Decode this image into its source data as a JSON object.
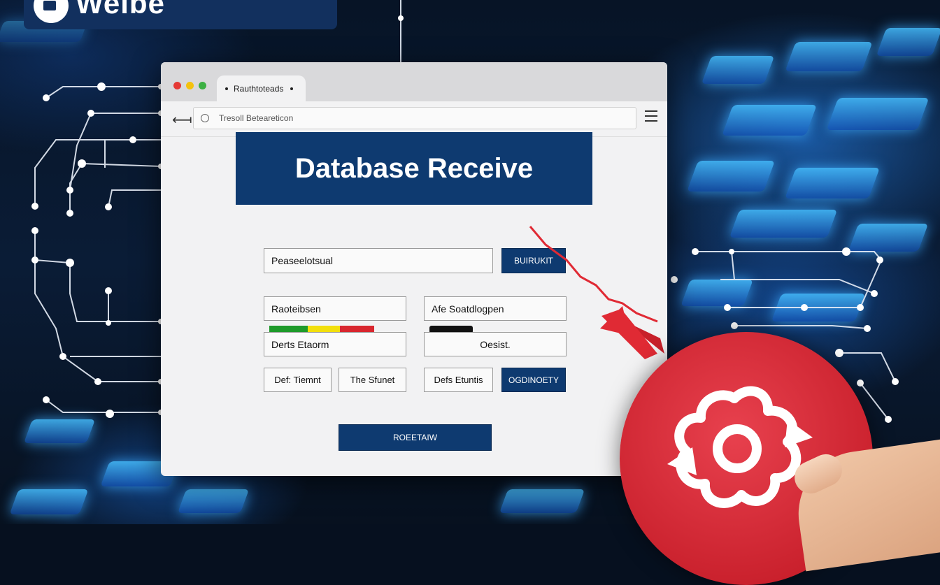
{
  "logo": {
    "text": "Weibe"
  },
  "browser": {
    "tab_title": "Rauthtoteads",
    "url_text": "Tresoll Beteareticon"
  },
  "page": {
    "title": "Database Receive",
    "top_input": "Peaseelotsual",
    "top_button": "BUIRUKIT",
    "left_field_1": "Raoteibsen",
    "left_field_2": "Derts Etaorm",
    "right_field_1": "Afe Soatdlogpen",
    "right_field_2": "Oesist.",
    "small_field_1": "Def: Tiemnt",
    "small_field_2": "The Sfunet",
    "small_field_3": "Defs Etuntis",
    "small_button": "OGDINOETY",
    "bottom_button": "ROEETAIW"
  },
  "colors": {
    "banner": "#0e3a70",
    "bar_green": "#1e9a2a",
    "bar_yellow": "#f2df0c",
    "bar_red": "#d8262e",
    "disc_red": "#d52a36"
  },
  "icons": [
    "logo-mark-icon",
    "back-arrow-icon",
    "search-icon",
    "hamburger-menu-icon",
    "gear-sync-icon",
    "red-arrow-icon"
  ]
}
